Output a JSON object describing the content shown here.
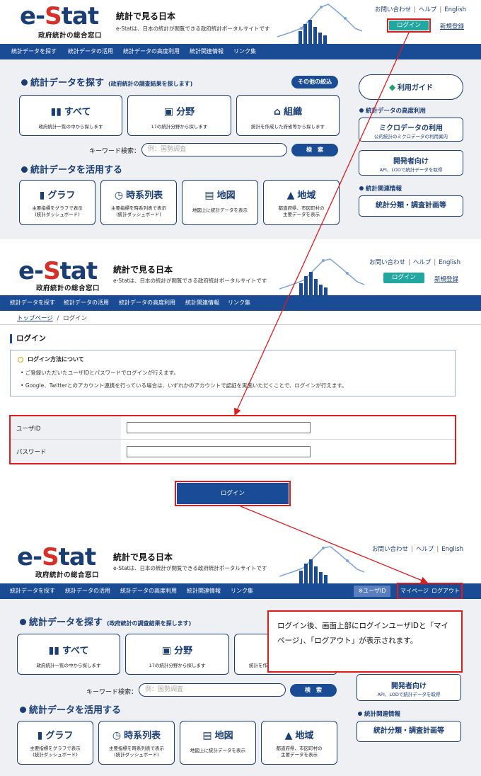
{
  "logo": {
    "e": "e-",
    "s": "S",
    "tat": "tat",
    "sub": "政府統計の総合窓口"
  },
  "site": {
    "title": "統計で見る日本",
    "desc": "e-Statは、日本の統計が閲覧できる政府統計ポータルサイトです"
  },
  "toplinks": {
    "contact": "お問い合わせ",
    "help": "ヘルプ",
    "english": "English",
    "sep": "|"
  },
  "login_small": "ログイン",
  "register": "新規登録",
  "nav": [
    "統計データを探す",
    "統計データの活用",
    "統計データの高度利用",
    "統計関連情報",
    "リンク集"
  ],
  "search": {
    "title": "統計データを探す",
    "subtitle": "(政府統計の調査結果を探します)",
    "other_btn": "その他の絞込",
    "cards": [
      {
        "title": "すべて",
        "desc": "政府統計一覧の中から探します"
      },
      {
        "title": "分野",
        "desc": "17の統計分野から探します"
      },
      {
        "title": "組織",
        "desc": "統計を作成した府省等から探します"
      }
    ],
    "keyword_label": "キーワード検索：",
    "keyword_placeholder": "例：国勢調査",
    "search_btn": "検　索"
  },
  "utilize": {
    "title": "統計データを活用する",
    "cards": [
      {
        "title": "グラフ",
        "desc1": "主要指標をグラフで表示",
        "desc2": "(統計ダッシュボード)"
      },
      {
        "title": "時系列表",
        "desc1": "主要指標を時系列表で表示",
        "desc2": "(統計ダッシュボード)"
      },
      {
        "title": "地図",
        "desc1": "地図上に統計データを表示",
        "desc2": ""
      },
      {
        "title": "地域",
        "desc1": "都道府県、市区町村の",
        "desc2": "主要データを表示"
      }
    ]
  },
  "side": {
    "guide": "利用ガイド",
    "advanced_head": "統計データの高度利用",
    "micro_title": "ミクロデータの利用",
    "micro_sub": "公的統計のミクロデータの利用案内",
    "dev_title": "開発者向け",
    "dev_sub": "API、LODで統計データを取得",
    "related_head": "統計関連情報",
    "classification": "統計分類・調査計画等"
  },
  "login_page": {
    "breadcrumb_top": "トップページ",
    "breadcrumb_sep": "/",
    "breadcrumb_current": "ログイン",
    "heading": "ログイン",
    "method_title": "ログイン方法について",
    "bullet1": "ご登録いただいたユーザIDとパスワードでログインが行えます。",
    "bullet2": "Google、Twitterとのアカウント連携を行っている場合は、いずれかのアカウントで認証を実施いただくことで、ログインが行えます。",
    "user_id_label": "ユーザID",
    "password_label": "パスワード",
    "login_button": "ログイン"
  },
  "after": {
    "userid_badge": "※ユーザID",
    "mypage": "マイページ",
    "logout": "ログアウト",
    "note": "ログイン後、画面上部にログインユーザIDと「マイページ」、「ログアウト」が表示されます。"
  },
  "colors": {
    "brand": "#1a3d73",
    "nav": "#1a4b95",
    "teal": "#22a7a0",
    "annotation": "#e11b1b",
    "logo_s": "#d6302b"
  }
}
